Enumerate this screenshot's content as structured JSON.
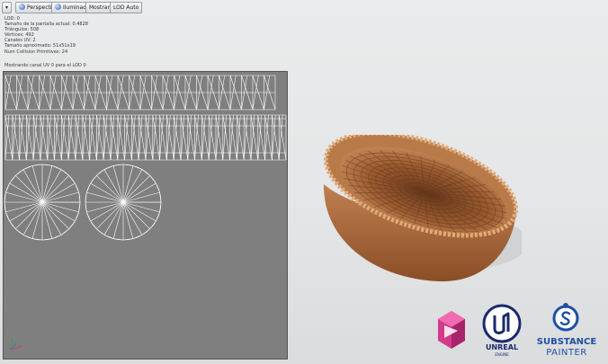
{
  "toolbar": {
    "menu_icon": "chevron-down-icon",
    "perspective_label": "Perspectiva",
    "lit_label": "Iluminado",
    "show_label": "Mostrar",
    "lod_label": "LOD Auto"
  },
  "stats": [
    "LOD:  0",
    "Tamaño de la pantalla actual: 0.4828",
    "Triángulos: 508",
    "Vértices: 492",
    "Canales UV: 2",
    "Tamaño aproximado: 51x51x19",
    "Num Collision Primitives:  24"
  ],
  "uv_caption": "Mostrando canal UV 0 para el LOD 0",
  "logos": {
    "substance_line1": "SUBSTANCE",
    "substance_line2": "PAINTER",
    "unreal_line1": "UNREAL",
    "unreal_line2": "ENGINE"
  },
  "colors": {
    "viewport_bg": "#e6e8e9",
    "uv_bg": "#7f7f7f",
    "wire": "#ffffff",
    "basket": "#a8683c",
    "substance_blue": "#1f4fa3",
    "logo_magenta": "#d23a8c",
    "unreal_navy": "#1a2a6c"
  }
}
